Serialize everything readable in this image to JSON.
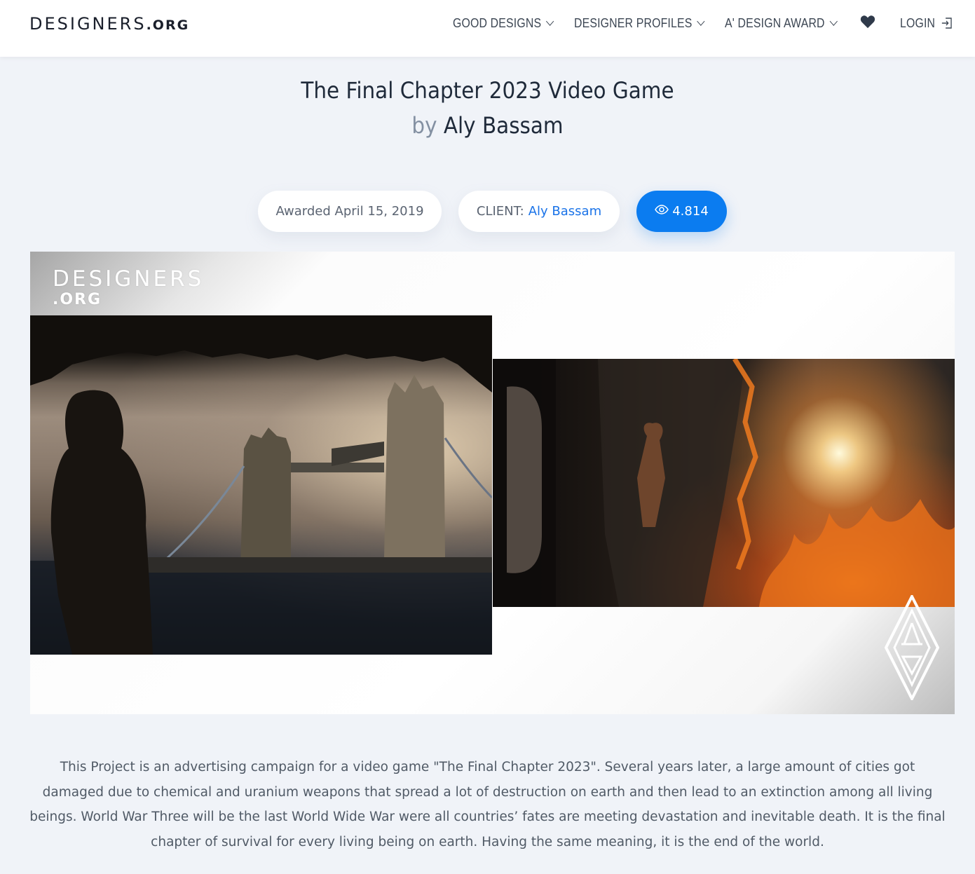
{
  "header": {
    "logo_main": "DESIGNERS",
    "logo_suffix": ".ORG",
    "nav": {
      "good_designs": "GOOD DESIGNS",
      "designer_profiles": "DESIGNER PROFILES",
      "design_award": "A' DESIGN AWARD",
      "login": "LOGIN"
    },
    "icons": [
      "chevron-down-icon",
      "heart-icon",
      "login-icon"
    ]
  },
  "project": {
    "title": "The Final Chapter 2023 Video Game",
    "by_label": "by",
    "designer": "Aly Bassam"
  },
  "meta": {
    "awarded": "Awarded April 15, 2019",
    "client_label": "CLIENT:",
    "client_name": "Aly Bassam",
    "views": "4.814"
  },
  "hero": {
    "watermark_main": "DESIGNERS",
    "watermark_suffix": ".ORG",
    "images": [
      "london-tower-bridge-ruins",
      "burning-aircraft-interior"
    ],
    "mark_icon": "a-design-award-mark-icon"
  },
  "description": "This Project is an advertising campaign for a video game \"The Final Chapter 2023\". Several years later, a large amount of cities got damaged due to chemical and uranium weapons that spread a lot of destruction on earth and then lead to an extinction among all living beings. World War Three will be the last World Wide War were all countries’ fates are meeting devastation and inevitable death. It is the final chapter of survival for every living being on earth. Having the same meaning, it is the end of the world.",
  "colors": {
    "accent": "#0b7cf0",
    "link": "#1a73e8",
    "background": "#f0f3f8",
    "header_bg": "#ffffff"
  }
}
